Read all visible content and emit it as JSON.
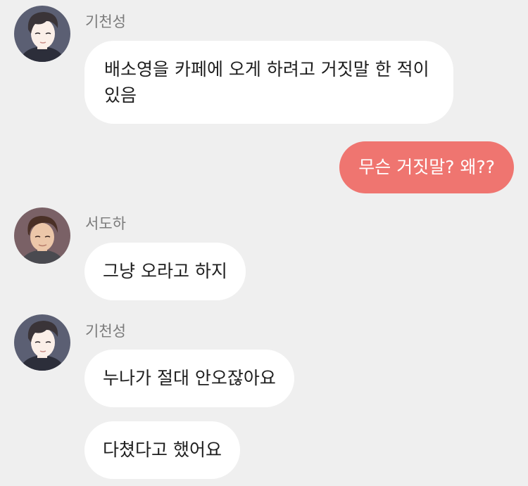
{
  "chat": {
    "messages": [
      {
        "sender": "기천성",
        "text": "배소영을 카페에 오게 하려고 거짓말 한 적이 있음",
        "side": "left"
      },
      {
        "sender": "",
        "text": "무슨 거짓말? 왜??",
        "side": "right"
      },
      {
        "sender": "서도하",
        "text": "그냥 오라고 하지",
        "side": "left"
      },
      {
        "sender": "기천성",
        "text": "누나가 절대 안오잖아요",
        "side": "left"
      },
      {
        "sender": "기천성",
        "text": "다쳤다고 했어요",
        "side": "left"
      }
    ]
  },
  "colors": {
    "background": "#efefef",
    "incoming_bubble": "#ffffff",
    "outgoing_bubble": "#ef7570",
    "sender_name": "#7b7b7b"
  },
  "icons": {
    "avatar_1": "gicheonseong-avatar-icon",
    "avatar_2": "seodoha-avatar-icon",
    "avatar_3": "gicheonseong-avatar-icon"
  }
}
